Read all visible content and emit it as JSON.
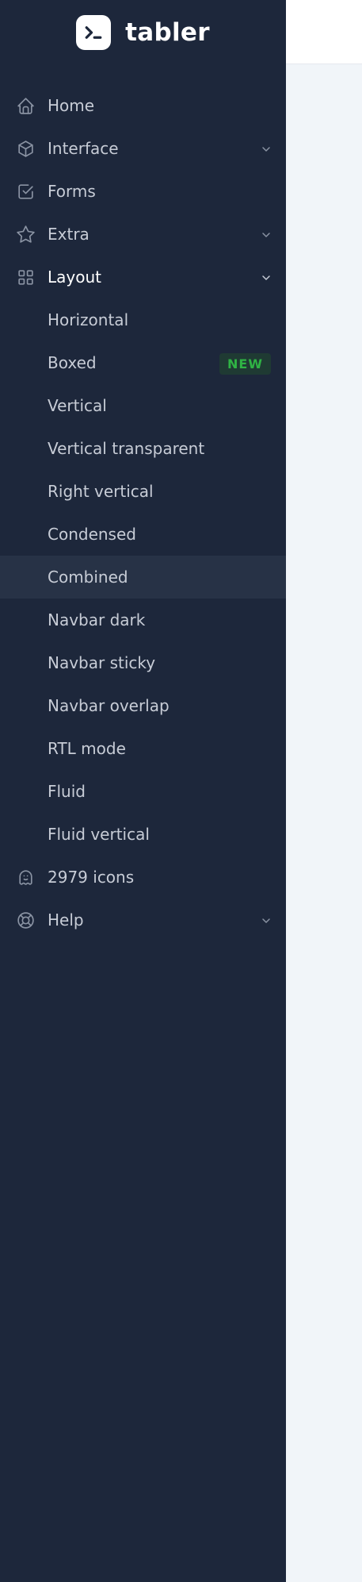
{
  "brand": {
    "name": "tabler",
    "logo_icon": "terminal-logo-icon"
  },
  "nav": {
    "home": {
      "label": "Home",
      "icon": "home-icon"
    },
    "interface": {
      "label": "Interface",
      "icon": "package-icon"
    },
    "forms": {
      "label": "Forms",
      "icon": "checkbox-icon"
    },
    "extra": {
      "label": "Extra",
      "icon": "star-icon"
    },
    "layout": {
      "label": "Layout",
      "icon": "layout-grid-icon",
      "items": [
        {
          "label": "Horizontal"
        },
        {
          "label": "Boxed",
          "badge": "NEW"
        },
        {
          "label": "Vertical"
        },
        {
          "label": "Vertical transparent"
        },
        {
          "label": "Right vertical"
        },
        {
          "label": "Condensed"
        },
        {
          "label": "Combined",
          "active": true
        },
        {
          "label": "Navbar dark"
        },
        {
          "label": "Navbar sticky"
        },
        {
          "label": "Navbar overlap"
        },
        {
          "label": "RTL mode"
        },
        {
          "label": "Fluid"
        },
        {
          "label": "Fluid vertical"
        }
      ]
    },
    "icons": {
      "label": "2979 icons",
      "icon": "ghost-icon"
    },
    "help": {
      "label": "Help",
      "icon": "lifebuoy-icon"
    }
  },
  "colors": {
    "sidebar_bg": "#1d273b",
    "active_bg": "#273246",
    "text": "#c7ccd6",
    "badge_green": "#2fb344",
    "main_bg": "#f1f5f9"
  }
}
